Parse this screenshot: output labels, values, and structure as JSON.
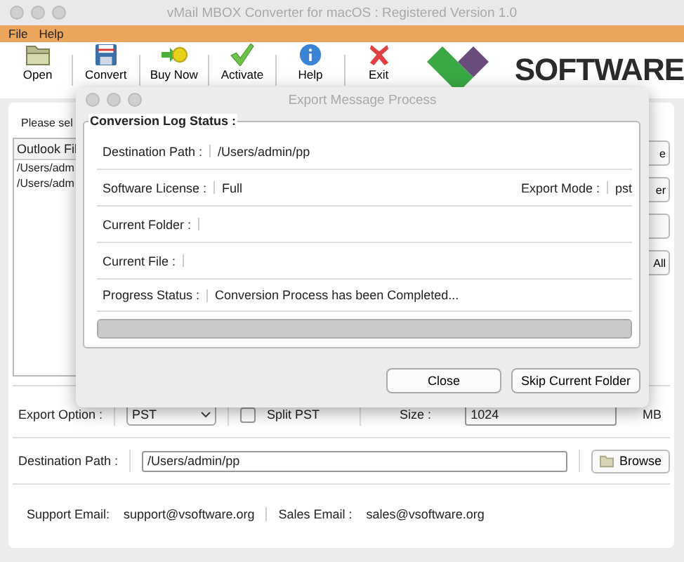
{
  "window": {
    "title": "vMail MBOX Converter for macOS : Registered Version 1.0"
  },
  "menu": [
    "File",
    "Help"
  ],
  "toolbar": [
    {
      "label": "Open",
      "kind": "open"
    },
    {
      "label": "Convert",
      "kind": "convert"
    },
    {
      "label": "Buy Now",
      "kind": "buy"
    },
    {
      "label": "Activate",
      "kind": "activate"
    },
    {
      "label": "Help",
      "kind": "help"
    },
    {
      "label": "Exit",
      "kind": "exit"
    }
  ],
  "logo": {
    "text": "SOFTWARE"
  },
  "main": {
    "prompt": "Please sel",
    "list_header": "Outlook Fil",
    "list_items": [
      "/Users/adm",
      "/Users/adm"
    ],
    "side_buttons": [
      {
        "kind": "text",
        "label": "e"
      },
      {
        "kind": "text",
        "label": "er"
      },
      {
        "kind": "blank"
      },
      {
        "kind": "text",
        "label": "All"
      }
    ],
    "export_option": {
      "label": "Export Option :",
      "value": "PST",
      "split_label": "Split PST",
      "split_checked": false,
      "size_label": "Size :",
      "size_value": "1024",
      "unit": "MB"
    },
    "destination": {
      "label": "Destination Path :",
      "value": "/Users/admin/pp",
      "button": "Browse"
    },
    "support": {
      "label": "Support Email:",
      "value": "support@vsoftware.org",
      "sales_label": "Sales Email :",
      "sales_value": "sales@vsoftware.org"
    }
  },
  "dialog": {
    "title": "Export Message Process",
    "group": "Conversion Log Status :",
    "rows": [
      {
        "label": "Destination Path :",
        "value": "/Users/admin/pp"
      },
      {
        "label": "Software License :",
        "value": "Full",
        "extra_label": "Export Mode :",
        "extra_value": "pst"
      },
      {
        "label": "Current Folder :",
        "value": ""
      },
      {
        "label": "Current File :",
        "value": ""
      },
      {
        "label": "Progress Status :",
        "value": "Conversion Process has been Completed..."
      }
    ],
    "progress": {
      "level": 1
    },
    "buttons": [
      "Close",
      "Skip Current Folder"
    ]
  }
}
